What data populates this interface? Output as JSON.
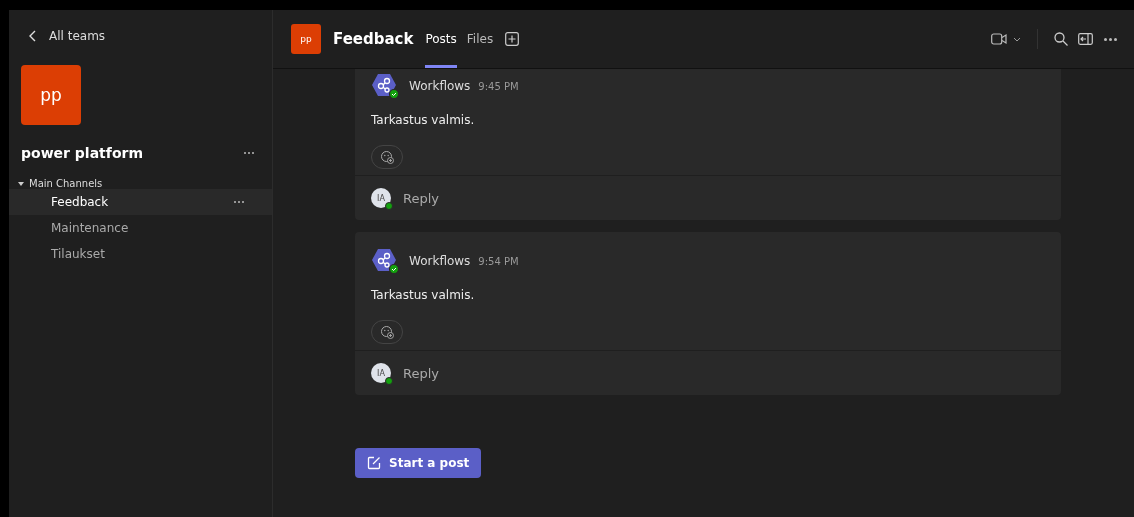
{
  "sidebar": {
    "back_label": "All teams",
    "team_avatar": "pp",
    "team_name": "power platform",
    "section": {
      "label": "Main Channels",
      "expanded": true
    },
    "channels": [
      {
        "name": "Feedback",
        "selected": true
      },
      {
        "name": "Maintenance",
        "selected": false
      },
      {
        "name": "Tilaukset",
        "selected": false
      }
    ]
  },
  "header": {
    "avatar": "pp",
    "channel": "Feedback",
    "tabs": [
      {
        "label": "Posts",
        "selected": true
      },
      {
        "label": "Files",
        "selected": false
      }
    ]
  },
  "posts": [
    {
      "author": "Workflows",
      "time": "9:45 PM",
      "text": "Tarkastus valmis.",
      "reply_avatar": "IA",
      "reply_label": "Reply",
      "top_cut": true
    },
    {
      "author": "Workflows",
      "time": "9:54 PM",
      "text": "Tarkastus valmis.",
      "reply_avatar": "IA",
      "reply_label": "Reply",
      "top_cut": false
    }
  ],
  "new_post_button": "Start a post"
}
